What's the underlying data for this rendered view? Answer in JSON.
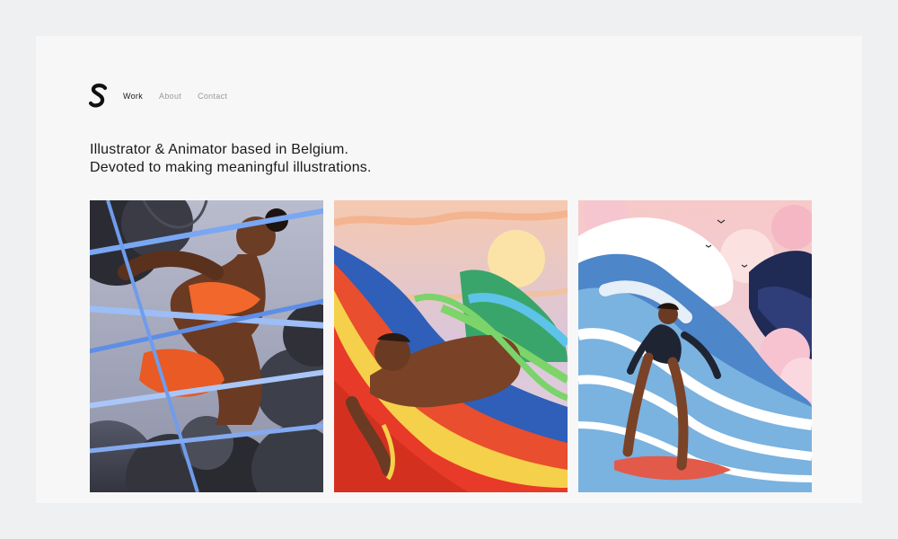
{
  "brand": {
    "logo_letter": "S"
  },
  "nav": {
    "items": [
      {
        "label": "Work",
        "active": true
      },
      {
        "label": "About",
        "active": false
      },
      {
        "label": "Contact",
        "active": false
      }
    ]
  },
  "intro": {
    "line1": "Illustrator & Animator based in Belgium.",
    "line2": "Devoted to making meaningful illustrations."
  },
  "gallery": {
    "items": [
      {
        "icon": "illustration-figure-in-clouds-and-ribbons"
      },
      {
        "icon": "illustration-reclining-figure-at-sunset"
      },
      {
        "icon": "illustration-surfer-in-wave"
      }
    ]
  },
  "colors": {
    "background": "#eef0f2",
    "page": "#f7f7f7",
    "text": "#1a1a1a",
    "nav_inactive": "#9a9a9a"
  }
}
